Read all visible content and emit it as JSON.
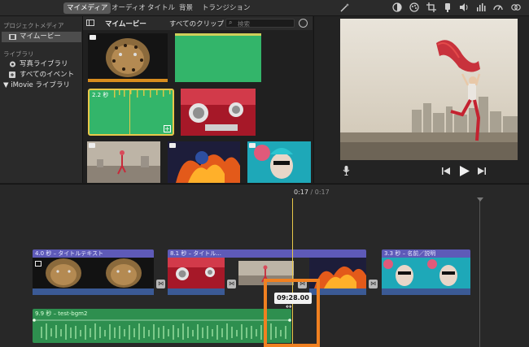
{
  "toolbar": {
    "tabs": [
      "マイメディア",
      "オーディオ",
      "タイトル",
      "背景",
      "トランジション"
    ],
    "active_tab": "マイメディア"
  },
  "sidebar": {
    "project_media_heading": "プロジェクトメディア",
    "project_item": "マイムービー",
    "library_heading": "ライブラリ",
    "items": [
      "写真ライブラリ",
      "すべてのイベント",
      "▼ iMovie ライブラリ"
    ]
  },
  "browser": {
    "title": "マイムービー",
    "filter": "すべてのクリップ ⌃",
    "search_placeholder": "検索",
    "clip_duration_badge": "2.2 秒"
  },
  "timeline": {
    "current_time": "0:17",
    "separator": "/",
    "total_time": "0:17",
    "clips": [
      {
        "title": "4.0 秒 – タイトルテキスト"
      },
      {
        "title": "8.1 秒 – タイトル..."
      },
      {
        "title": "3.3 秒 – 名前／説明"
      }
    ],
    "audio_clip": "9.9 秒 – test-bgm2",
    "tooltip_time": "09:28.00"
  },
  "icons": {
    "sidebar_toggle": "sidebar-toggle-icon",
    "settings": "gear-icon",
    "magic": "magic-wand-icon",
    "mic": "microphone-icon",
    "prev": "skip-back-icon",
    "play": "play-icon",
    "next": "skip-forward-icon"
  },
  "colors": {
    "accent_selection": "#5a5a5a",
    "title_bar": "#5e5ab8",
    "audio": "#2e8f4f",
    "playhead": "#e8c84a",
    "highlight": "#f08020"
  }
}
